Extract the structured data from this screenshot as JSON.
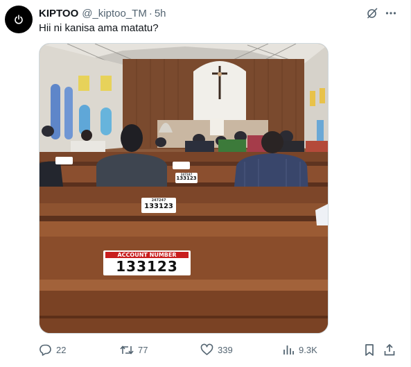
{
  "author": {
    "display_name": "KIPTOO",
    "handle": "@_kiptoo_TM",
    "separator": "·",
    "time": "5h",
    "avatar_icon": "power-logo-icon"
  },
  "tweet": {
    "text": "Hii ni kanisa ama matatu?"
  },
  "media": {
    "description_icon": "church-photo",
    "sign_heading": "ACCOUNT NUMBER",
    "sign_number": "133123",
    "sign_small_label": "247247"
  },
  "actions": {
    "replies": "22",
    "reposts": "77",
    "likes": "339",
    "views": "9.3K"
  },
  "colors": {
    "text_primary": "#0f1419",
    "text_secondary": "#536471",
    "border": "#cfd9de"
  }
}
